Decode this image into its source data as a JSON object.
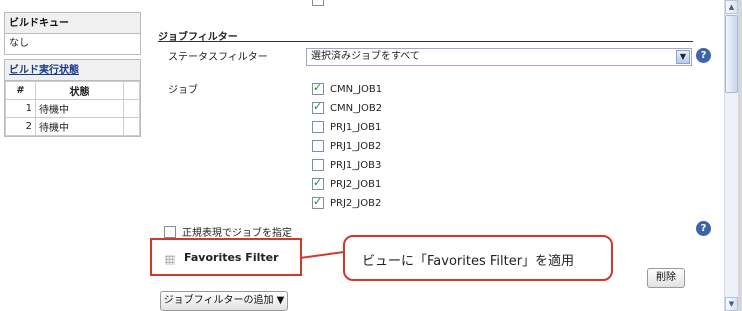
{
  "sidebar": {
    "build_queue": {
      "title": "ビルドキュー",
      "empty_text": "なし"
    },
    "executor_status": {
      "title": "ビルド実行状態",
      "columns": [
        "#",
        "状態"
      ],
      "rows": [
        {
          "num": "1",
          "state": "待機中"
        },
        {
          "num": "2",
          "state": "待機中"
        }
      ]
    }
  },
  "main": {
    "section_title": "ジョブフィルター",
    "status_filter_label": "ステータスフィルター",
    "status_filter_value": "選択済みジョブをすべて",
    "jobs_label": "ジョブ",
    "jobs": [
      {
        "name": "CMN_JOB1",
        "checked": true
      },
      {
        "name": "CMN_JOB2",
        "checked": true
      },
      {
        "name": "PRJ1_JOB1",
        "checked": false
      },
      {
        "name": "PRJ1_JOB2",
        "checked": false
      },
      {
        "name": "PRJ1_JOB3",
        "checked": false
      },
      {
        "name": "PRJ2_JOB1",
        "checked": true
      },
      {
        "name": "PRJ2_JOB2",
        "checked": true
      }
    ],
    "regex_label": "正規表現でジョブを指定",
    "filter_name": "Favorites Filter",
    "callout_text": "ビューに「Favorites Filter」を適用",
    "delete_label": "削除",
    "add_filter_label": "ジョブフィルターの追加 ▼",
    "help_glyph": "?"
  },
  "icons": {
    "help": "help-icon",
    "dropdown": "chevron-down-icon",
    "grip": "drag-handle-icon"
  },
  "colors": {
    "accent_red": "#d03a2a",
    "help_blue": "#3d64a8",
    "link_blue": "#1a3a8a"
  }
}
